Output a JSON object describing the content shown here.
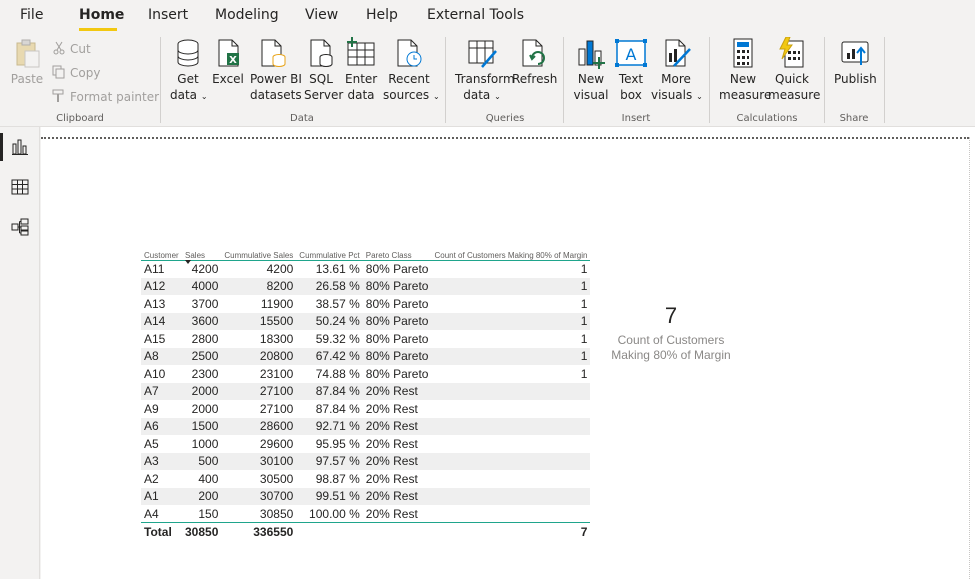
{
  "menu": {
    "file": "File",
    "home": "Home",
    "insert": "Insert",
    "modeling": "Modeling",
    "view": "View",
    "help": "Help",
    "external_tools": "External Tools"
  },
  "ribbon": {
    "clipboard": {
      "label": "Clipboard",
      "paste": "Paste",
      "cut": "Cut",
      "copy": "Copy",
      "format_painter": "Format painter"
    },
    "data": {
      "label": "Data",
      "get_data_1": "Get",
      "get_data_2": "data",
      "excel": "Excel",
      "pbi_1": "Power BI",
      "pbi_2": "datasets",
      "sql_1": "SQL",
      "sql_2": "Server",
      "enter_1": "Enter",
      "enter_2": "data",
      "recent_1": "Recent",
      "recent_2": "sources"
    },
    "queries": {
      "label": "Queries",
      "transform_1": "Transform",
      "transform_2": "data",
      "refresh": "Refresh"
    },
    "insert": {
      "label": "Insert",
      "new_visual_1": "New",
      "new_visual_2": "visual",
      "text_box_1": "Text",
      "text_box_2": "box",
      "more_visuals_1": "More",
      "more_visuals_2": "visuals"
    },
    "calculations": {
      "label": "Calculations",
      "new_measure_1": "New",
      "new_measure_2": "measure",
      "quick_measure_1": "Quick",
      "quick_measure_2": "measure"
    },
    "share": {
      "label": "Share",
      "publish": "Publish"
    }
  },
  "table": {
    "headers": [
      "Customer",
      "Sales",
      "Cummulative Sales",
      "Cummulative Pct",
      "Pareto Class",
      "Count of Customers Making 80% of Margin"
    ],
    "rows": [
      [
        "A11",
        "4200",
        "4200",
        "13.61 %",
        "80% Pareto",
        "1"
      ],
      [
        "A12",
        "4000",
        "8200",
        "26.58 %",
        "80% Pareto",
        "1"
      ],
      [
        "A13",
        "3700",
        "11900",
        "38.57 %",
        "80% Pareto",
        "1"
      ],
      [
        "A14",
        "3600",
        "15500",
        "50.24 %",
        "80% Pareto",
        "1"
      ],
      [
        "A15",
        "2800",
        "18300",
        "59.32 %",
        "80% Pareto",
        "1"
      ],
      [
        "A8",
        "2500",
        "20800",
        "67.42 %",
        "80% Pareto",
        "1"
      ],
      [
        "A10",
        "2300",
        "23100",
        "74.88 %",
        "80% Pareto",
        "1"
      ],
      [
        "A7",
        "2000",
        "27100",
        "87.84 %",
        "20% Rest",
        ""
      ],
      [
        "A9",
        "2000",
        "27100",
        "87.84 %",
        "20% Rest",
        ""
      ],
      [
        "A6",
        "1500",
        "28600",
        "92.71 %",
        "20% Rest",
        ""
      ],
      [
        "A5",
        "1000",
        "29600",
        "95.95 %",
        "20% Rest",
        ""
      ],
      [
        "A3",
        "500",
        "30100",
        "97.57 %",
        "20% Rest",
        ""
      ],
      [
        "A2",
        "400",
        "30500",
        "98.87 %",
        "20% Rest",
        ""
      ],
      [
        "A1",
        "200",
        "30700",
        "99.51 %",
        "20% Rest",
        ""
      ],
      [
        "A4",
        "150",
        "30850",
        "100.00 %",
        "20% Rest",
        ""
      ]
    ],
    "total": [
      "Total",
      "30850",
      "336550",
      "",
      "",
      "7"
    ]
  },
  "card": {
    "value": "7",
    "label_1": "Count of Customers",
    "label_2": "Making 80% of Margin"
  }
}
